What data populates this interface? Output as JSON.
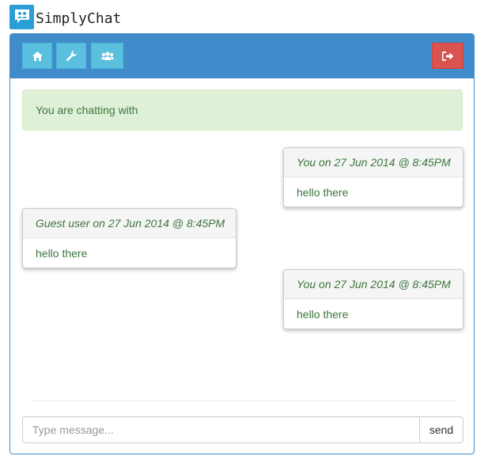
{
  "app": {
    "title": "SimplyChat"
  },
  "toolbar": {
    "buttons": [
      {
        "icon": "home-icon",
        "color": "#5bc0de"
      },
      {
        "icon": "wrench-icon",
        "color": "#5bc0de"
      },
      {
        "icon": "users-icon",
        "color": "#5bc0de"
      },
      {
        "icon": "sign-out-icon",
        "color": "#d9534f"
      }
    ]
  },
  "alert": {
    "text": "You are chatting with"
  },
  "messages": [
    {
      "sender": "You on 27 Jun 2014 @ 8:45PM",
      "text": "hello there",
      "align": "right"
    },
    {
      "sender": "Guest user on 27 Jun 2014 @ 8:45PM",
      "text": "hello there",
      "align": "left"
    },
    {
      "sender": "You on 27 Jun 2014 @ 8:45PM",
      "text": "hello there",
      "align": "right"
    }
  ],
  "composer": {
    "placeholder": "Type message...",
    "value": "",
    "send_label": "send"
  },
  "colors": {
    "primary": "#428bca",
    "info": "#5bc0de",
    "danger": "#d9534f",
    "success_text": "#3c763d",
    "success_bg": "#dff0d8"
  }
}
